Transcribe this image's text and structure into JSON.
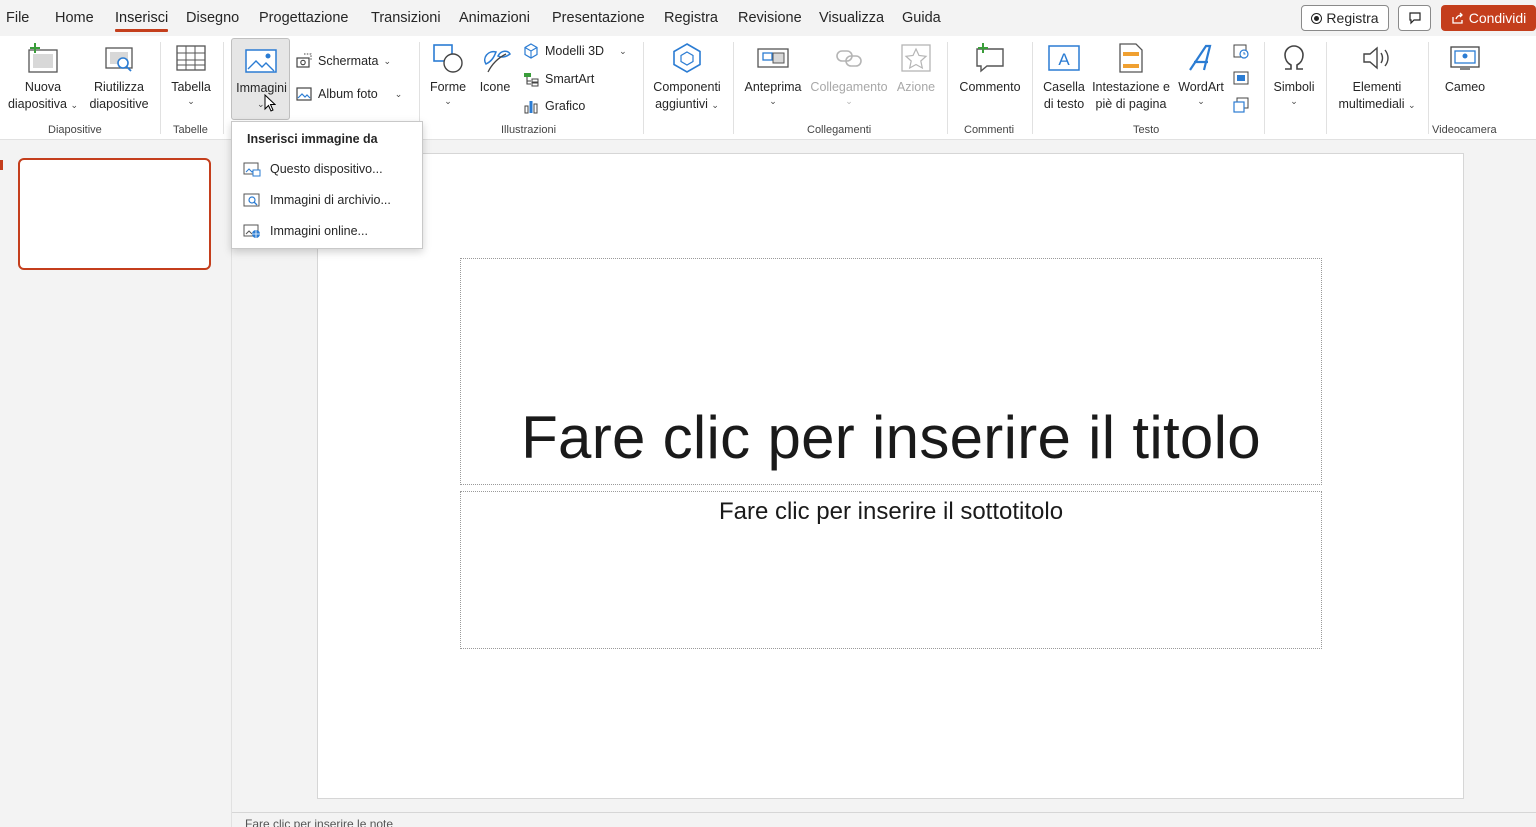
{
  "tabs": [
    {
      "label": "File",
      "active": false
    },
    {
      "label": "Home",
      "active": false
    },
    {
      "label": "Inserisci",
      "active": true
    },
    {
      "label": "Disegno",
      "active": false
    },
    {
      "label": "Progettazione",
      "active": false
    },
    {
      "label": "Transizioni",
      "active": false
    },
    {
      "label": "Animazioni",
      "active": false
    },
    {
      "label": "Presentazione",
      "active": false
    },
    {
      "label": "Registra",
      "active": false
    },
    {
      "label": "Revisione",
      "active": false
    },
    {
      "label": "Visualizza",
      "active": false
    },
    {
      "label": "Guida",
      "active": false
    }
  ],
  "top_actions": {
    "record_label": "Registra",
    "share_label": "Condividi"
  },
  "ribbon": {
    "groups": {
      "diapositive": "Diapositive",
      "tabelle": "Tabelle",
      "illustrazioni": "Illustrazioni",
      "collegamenti": "Collegamenti",
      "commenti": "Commenti",
      "testo": "Testo",
      "videocamera": "Videocamera"
    },
    "nuova_line1": "Nuova",
    "nuova_line2": "diapositiva",
    "riutilizza_line1": "Riutilizza",
    "riutilizza_line2": "diapositive",
    "tabella": "Tabella",
    "immagini": "Immagini",
    "schermata": "Schermata",
    "album_foto": "Album foto",
    "forme": "Forme",
    "icone": "Icone",
    "modelli_3d": "Modelli 3D",
    "smartart": "SmartArt",
    "grafico": "Grafico",
    "componenti_line1": "Componenti",
    "componenti_line2": "aggiuntivi",
    "anteprima": "Anteprima",
    "collegamento": "Collegamento",
    "azione": "Azione",
    "commento": "Commento",
    "casella_line1": "Casella",
    "casella_line2": "di testo",
    "intestazione_line1": "Intestazione e",
    "intestazione_line2": "piè di pagina",
    "wordart": "WordArt",
    "simboli": "Simboli",
    "elementi_line1": "Elementi",
    "elementi_line2": "multimediali",
    "cameo": "Cameo"
  },
  "dropdown": {
    "heading": "Inserisci immagine da",
    "items": [
      {
        "label": "Questo dispositivo...",
        "icon": "device-image-icon"
      },
      {
        "label": "Immagini di archivio...",
        "icon": "stock-images-icon"
      },
      {
        "label": "Immagini online...",
        "icon": "online-images-icon"
      }
    ]
  },
  "slide": {
    "title_placeholder": "Fare clic per inserire il titolo",
    "subtitle_placeholder": "Fare clic per inserire il sottotitolo"
  },
  "notes_hint": "Fare clic per inserire le note",
  "colors": {
    "accent": "#c43e1c",
    "ribbon_bg": "#ffffff",
    "app_bg": "#f3f3f3",
    "icon_blue": "#2b7cd3"
  }
}
